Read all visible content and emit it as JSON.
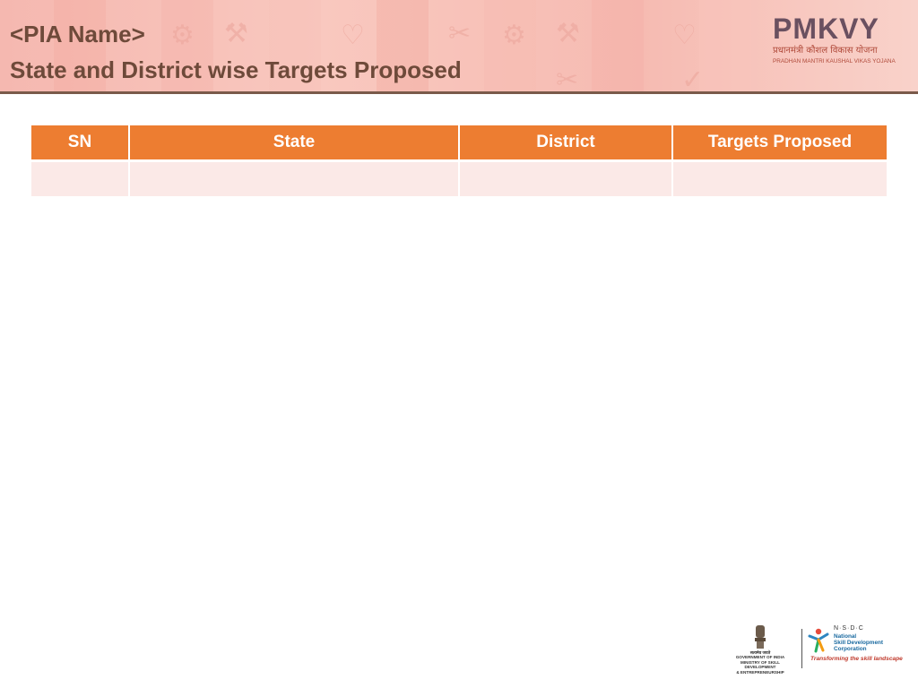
{
  "header": {
    "title_line1": "<PIA Name>",
    "title_line2": "State and District wise Targets Proposed",
    "background_color": "#f7bcb3",
    "title_color": "#6e4a3a"
  },
  "logo": {
    "wordmark": "PMKVY",
    "hindi": "प्रधानमंत्री कौशल विकास योजना",
    "subtitle": "PRADHAN MANTRI KAUSHAL VIKAS YOJANA"
  },
  "table": {
    "header_color": "#ed7d31",
    "row_color": "#fbe9e7",
    "columns": [
      "SN",
      "State",
      "District",
      "Targets Proposed"
    ],
    "rows": [
      [
        "",
        "",
        "",
        ""
      ]
    ]
  },
  "footer": {
    "gov_line1": "सत्यमेव जयते",
    "gov_line2": "GOVERNMENT OF INDIA",
    "gov_line3": "MINISTRY OF SKILL DEVELOPMENT",
    "gov_line4": "& ENTREPRENEURSHIP",
    "nsdc_letters": "N·S·D·C",
    "nsdc_name": "National\nSkill Development\nCorporation",
    "nsdc_tagline": "Transforming the skill landscape"
  }
}
